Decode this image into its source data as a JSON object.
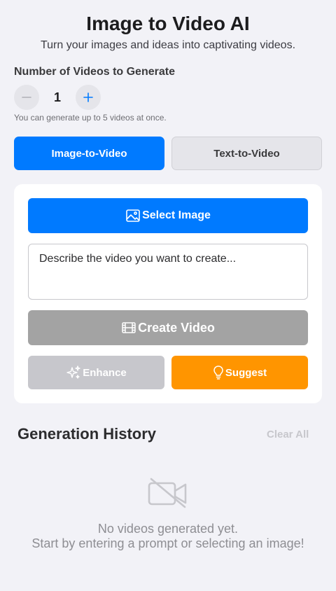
{
  "header": {
    "title": "Image to Video AI",
    "subtitle": "Turn your images and ideas into captivating videos."
  },
  "count": {
    "label": "Number of Videos to Generate",
    "value": "1",
    "hint": "You can generate up to 5 videos at once."
  },
  "tabs": [
    {
      "label": "Image-to-Video",
      "active": true
    },
    {
      "label": "Text-to-Video",
      "active": false
    }
  ],
  "actions": {
    "select_image": "Select Image",
    "prompt_placeholder": "Describe the video you want to create...",
    "create_video": "Create Video",
    "enhance": "Enhance",
    "suggest": "Suggest"
  },
  "history": {
    "title": "Generation History",
    "clear_all": "Clear All",
    "empty_line1": "No videos generated yet.",
    "empty_line2": "Start by entering a prompt or selecting an image!"
  },
  "icons": {
    "minus": "minus-icon",
    "plus": "plus-icon",
    "image": "image-icon",
    "film": "film-icon",
    "sparkles": "sparkles-icon",
    "lightbulb": "lightbulb-icon",
    "video_off": "video-off-icon"
  },
  "colors": {
    "primary": "#007aff",
    "orange": "#ff9500",
    "disabled": "#a3a3a3",
    "background": "#f2f2f7"
  }
}
